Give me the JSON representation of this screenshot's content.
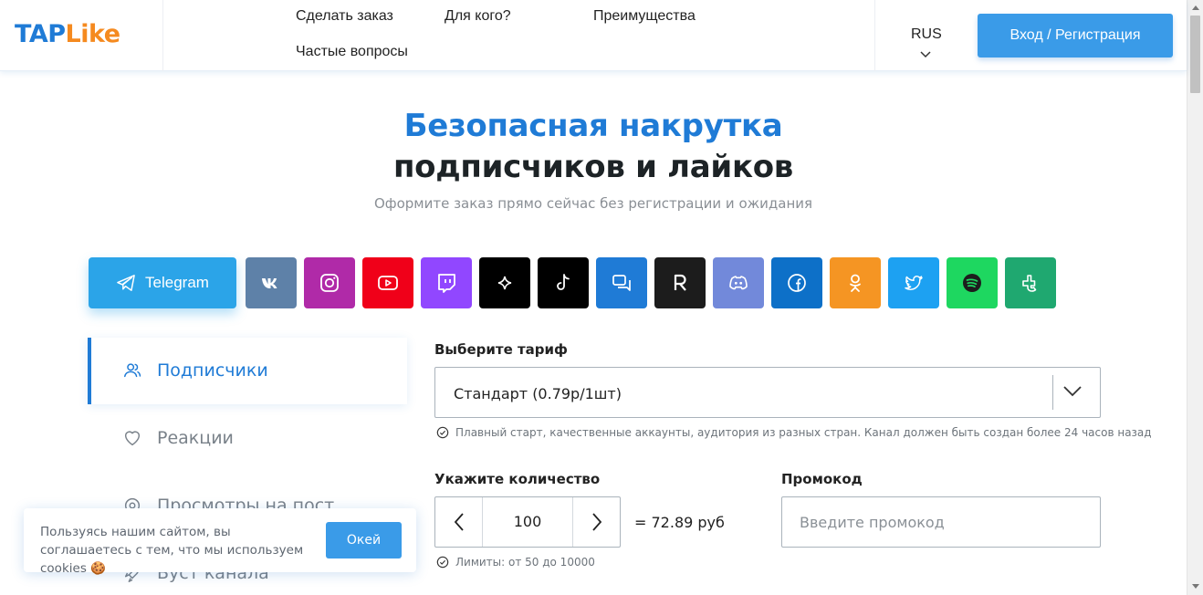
{
  "header": {
    "logo_tap": "TAP",
    "logo_like": "Like",
    "nav": [
      "Сделать заказ",
      "Для кого?",
      "Преимущества",
      "Частые вопросы"
    ],
    "lang": "RUS",
    "login": "Вход / Регистрация"
  },
  "hero": {
    "title_line1": "Безопасная накрутка",
    "title_line2": "подписчиков и лайков",
    "subtitle": "Оформите заказ прямо сейчас без регистрации и ожидания"
  },
  "platforms": {
    "active_label": "Telegram",
    "items": [
      {
        "icon": "vk-icon",
        "color": "#5e81a8"
      },
      {
        "icon": "instagram-icon",
        "color": "#b02aa8"
      },
      {
        "icon": "youtube-icon",
        "color": "#f00019"
      },
      {
        "icon": "twitch-icon",
        "color": "#9147ff"
      },
      {
        "icon": "sparkle-icon",
        "color": "#000000"
      },
      {
        "icon": "tiktok-icon",
        "color": "#000000"
      },
      {
        "icon": "chat-icon",
        "color": "#1f7bd6"
      },
      {
        "icon": "r-icon",
        "color": "#1c1c1c"
      },
      {
        "icon": "discord-icon",
        "color": "#7289da"
      },
      {
        "icon": "facebook-icon",
        "color": "#0d70c8"
      },
      {
        "icon": "odnoklassniki-icon",
        "color": "#f59523"
      },
      {
        "icon": "twitter-icon",
        "color": "#1da1f2"
      },
      {
        "icon": "spotify-icon",
        "color": "#1ed760"
      },
      {
        "icon": "tiktok-alt-icon",
        "color": "#1fa870"
      }
    ]
  },
  "side_menu": {
    "items": [
      "Подписчики",
      "Реакции",
      "Просмотры на пост",
      "Буст канала"
    ]
  },
  "form": {
    "tariff_label": "Выберите тариф",
    "tariff_value": "Стандарт (0.79р/1шт)",
    "tariff_hint": "Плавный старт, качественные аккаунты, аудитория из разных стран. Канал должен быть создан более 24 часов назад",
    "qty_label": "Укажите количество",
    "qty_value": "100",
    "price": "= 72.89 руб",
    "limits": "Лимиты: от 50 до 10000",
    "promo_label": "Промокод",
    "promo_placeholder": "Введите промокод"
  },
  "cookie": {
    "text": "Пользуясь нашим сайтом, вы соглашаетесь с тем, что мы используем cookies 🍪",
    "button": "Окей"
  },
  "colors": {
    "brand_blue": "#1f7bd6",
    "brand_orange": "#f58a1f",
    "button_blue": "#3a9be8",
    "telegram": "#2ba4e8"
  }
}
